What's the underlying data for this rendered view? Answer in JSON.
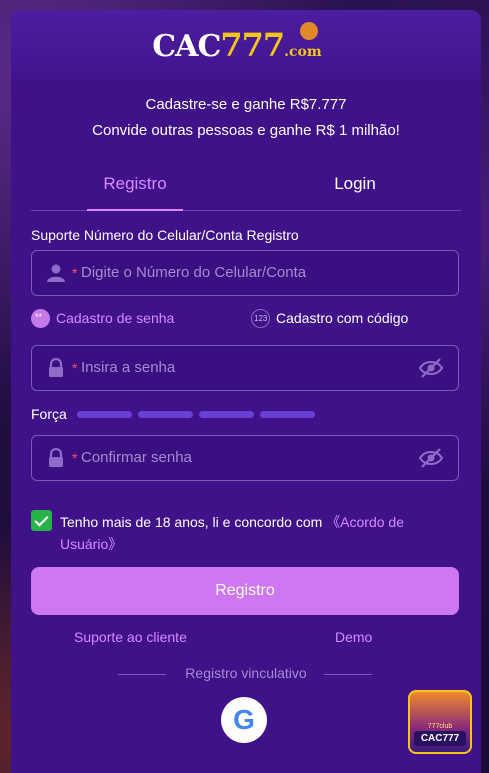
{
  "logo": {
    "part1": "CAC",
    "part2": "777",
    "part3": ".com"
  },
  "promo": {
    "line1": "Cadastre-se e ganhe R$7.777",
    "line2": "Convide outras pessoas e ganhe R$ 1 milhão!"
  },
  "tabs": {
    "register": "Registro",
    "login": "Login"
  },
  "account_label": "Suporte Número do Celular/Conta Registro",
  "phone_field": {
    "required_mark": "*",
    "placeholder": "Digite o Número do Celular/Conta"
  },
  "register_modes": {
    "password": "Cadastro de senha",
    "code": "Cadastro com código"
  },
  "password_field": {
    "required_mark": "*",
    "placeholder": "Insira a senha"
  },
  "strength": {
    "label": "Força",
    "level": 0
  },
  "confirm_field": {
    "required_mark": "*",
    "placeholder": "Confirmar senha"
  },
  "agreement": {
    "checked": true,
    "text": "Tenho mais de 18 anos, li e concordo com ",
    "link": "《Acordo de Usuário》"
  },
  "submit_label": "Registro",
  "links": {
    "support": "Suporte ao cliente",
    "demo": "Demo"
  },
  "bind_label": "Registro vinculativo",
  "google_glyph": "G",
  "floating_badge": {
    "small": "777club",
    "text": "CAC777"
  },
  "colors": {
    "accent": "#d98aff",
    "button": "#cf77f0",
    "modal_bg": "#3f128a",
    "check": "#27b24a"
  }
}
